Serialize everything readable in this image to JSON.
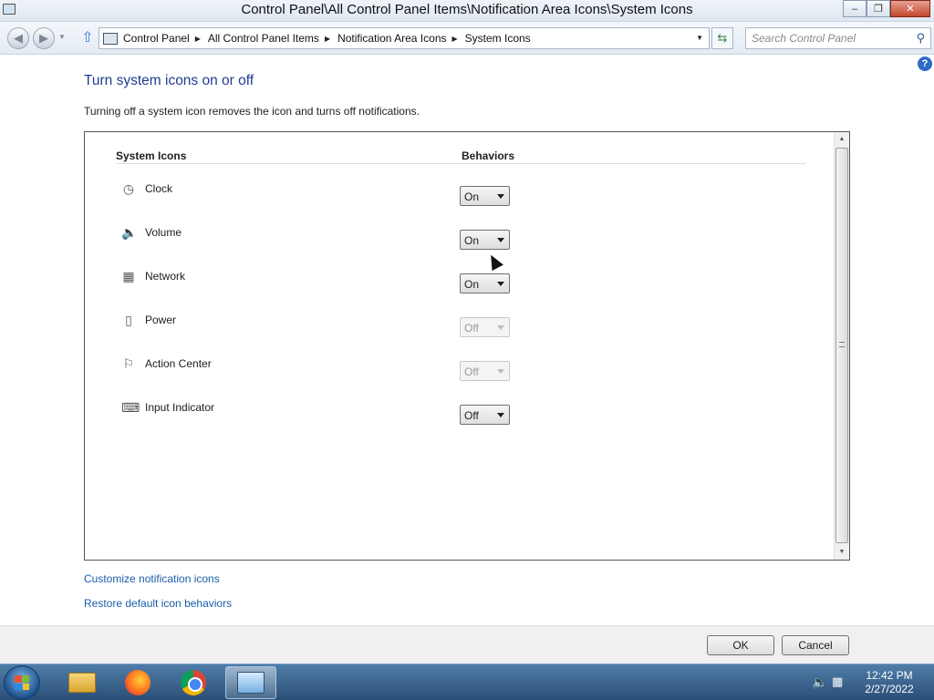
{
  "window": {
    "title": "Control Panel\\All Control Panel Items\\Notification Area Icons\\System Icons",
    "minimize_glyph": "‒",
    "restore_glyph": "❐",
    "close_glyph": "✕"
  },
  "address_bar": {
    "breadcrumbs": [
      "Control Panel",
      "All Control Panel Items",
      "Notification Area Icons",
      "System Icons"
    ],
    "search_placeholder": "Search Control Panel"
  },
  "main": {
    "title": "Turn system icons on or off",
    "description": "Turning off a system icon removes the icon and turns off notifications.",
    "columns": {
      "icons": "System Icons",
      "behaviors": "Behaviors"
    },
    "items": [
      {
        "label": "Clock",
        "value": "On",
        "icon": "clock-icon",
        "enabled": true
      },
      {
        "label": "Volume",
        "value": "On",
        "icon": "volume-icon",
        "enabled": true
      },
      {
        "label": "Network",
        "value": "On",
        "icon": "network-icon",
        "enabled": true
      },
      {
        "label": "Power",
        "value": "Off",
        "icon": "power-icon",
        "enabled": false
      },
      {
        "label": "Action Center",
        "value": "Off",
        "icon": "flag-icon",
        "enabled": false
      },
      {
        "label": "Input Indicator",
        "value": "Off",
        "icon": "keyboard-icon",
        "enabled": true
      }
    ],
    "links": {
      "customize": "Customize notification icons",
      "restore": "Restore default icon behaviors"
    }
  },
  "footer": {
    "ok": "OK",
    "cancel": "Cancel"
  },
  "taskbar": {
    "apps": [
      "Windows Explorer",
      "Firefox",
      "Chrome",
      "Control Panel"
    ],
    "time": "12:42 PM",
    "date": "2/27/2022"
  },
  "colors": {
    "title": "#1e3d8f",
    "link": "#1a5ea8",
    "taskbar": "#2b4f77"
  }
}
